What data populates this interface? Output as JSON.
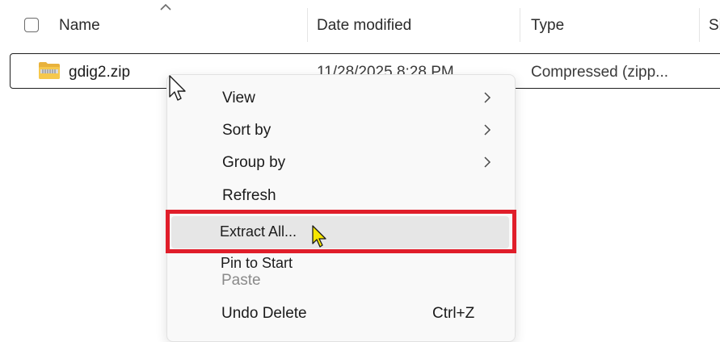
{
  "header": {
    "name_label": "Name",
    "date_label": "Date modified",
    "type_label": "Type",
    "size_label_partial": "Si"
  },
  "file_row": {
    "name": "gdig2.zip",
    "date_modified": "11/28/2025 8:28 PM",
    "type": "Compressed (zipp..."
  },
  "context_menu": {
    "items": [
      {
        "label": "View",
        "has_submenu": true
      },
      {
        "label": "Sort by",
        "has_submenu": true
      },
      {
        "label": "Group by",
        "has_submenu": true
      },
      {
        "label": "Refresh"
      },
      {
        "label": "Extract All...",
        "highlighted": true
      },
      {
        "label": "Pin to Start"
      },
      {
        "label": "Paste",
        "disabled": true
      },
      {
        "label": "Undo Delete",
        "shortcut": "Ctrl+Z"
      }
    ]
  },
  "colors": {
    "highlight_frame": "#e01e2a",
    "menu_background": "#f9f9f9",
    "disabled_text": "#8a8a8a",
    "yellow_cursor": "#f5e600"
  }
}
